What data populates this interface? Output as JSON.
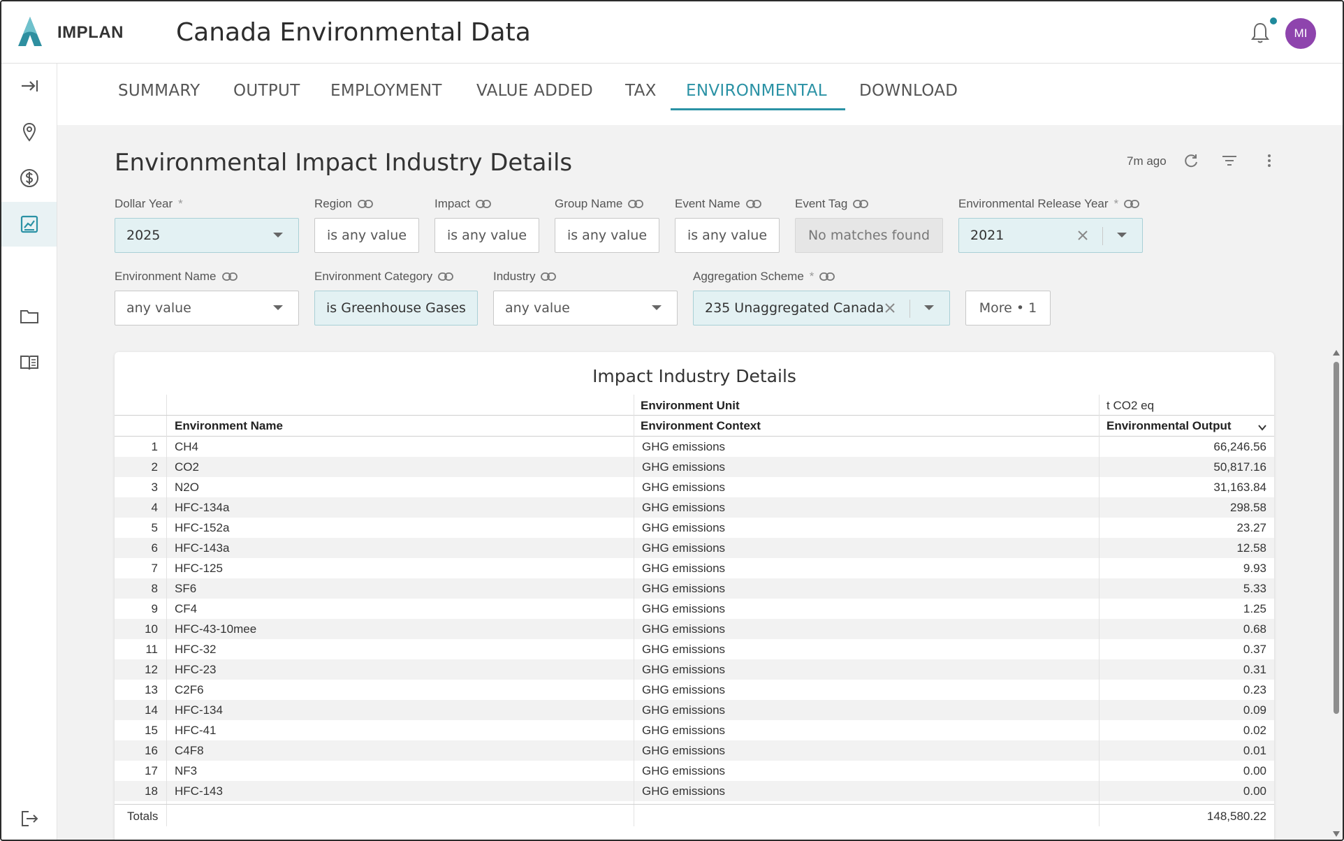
{
  "header": {
    "brand": "IMPLAN",
    "app_title": "Canada Environmental Data",
    "avatar_initials": "MI"
  },
  "sidebar": {
    "items": [
      {
        "icon": "collapse-arrow-icon"
      },
      {
        "icon": "location-pin-icon"
      },
      {
        "icon": "dollar-icon"
      },
      {
        "icon": "chart-icon",
        "active": true
      },
      {
        "icon": "folder-icon"
      },
      {
        "icon": "book-icon"
      },
      {
        "icon": "logout-icon"
      }
    ]
  },
  "tabs": [
    {
      "label": "SUMMARY"
    },
    {
      "label": "OUTPUT"
    },
    {
      "label": "EMPLOYMENT"
    },
    {
      "label": "VALUE ADDED"
    },
    {
      "label": "TAX"
    },
    {
      "label": "ENVIRONMENTAL",
      "active": true
    },
    {
      "label": "DOWNLOAD"
    }
  ],
  "page": {
    "title": "Environmental Impact Industry Details",
    "updated": "7m ago"
  },
  "filters": {
    "dollar_year": {
      "label": "Dollar Year",
      "required": "*",
      "value": "2025"
    },
    "region": {
      "label": "Region",
      "value": "is any value"
    },
    "impact": {
      "label": "Impact",
      "value": "is any value"
    },
    "group_name": {
      "label": "Group Name",
      "value": "is any value"
    },
    "event_name": {
      "label": "Event Name",
      "value": "is any value"
    },
    "event_tag": {
      "label": "Event Tag",
      "value": "No matches found"
    },
    "env_release_year": {
      "label": "Environmental Release Year",
      "required": "*",
      "value": "2021"
    },
    "environment_name": {
      "label": "Environment Name",
      "value": "any value"
    },
    "environment_category": {
      "label": "Environment Category",
      "value": "is Greenhouse Gases"
    },
    "industry": {
      "label": "Industry",
      "value": "any value"
    },
    "aggregation_scheme": {
      "label": "Aggregation Scheme",
      "required": "*",
      "value": "235 Unaggregated Canada"
    },
    "more": {
      "label": "More • 1"
    }
  },
  "table": {
    "title": "Impact Industry Details",
    "header_top": {
      "unit_label": "Environment Unit",
      "unit_value": "t CO2 eq"
    },
    "columns": {
      "name": "Environment Name",
      "context": "Environment Context",
      "output": "Environmental Output"
    },
    "rows": [
      {
        "idx": "1",
        "name": "CH4",
        "context": "GHG emissions",
        "value": "66,246.56"
      },
      {
        "idx": "2",
        "name": "CO2",
        "context": "GHG emissions",
        "value": "50,817.16"
      },
      {
        "idx": "3",
        "name": "N2O",
        "context": "GHG emissions",
        "value": "31,163.84"
      },
      {
        "idx": "4",
        "name": "HFC-134a",
        "context": "GHG emissions",
        "value": "298.58"
      },
      {
        "idx": "5",
        "name": "HFC-152a",
        "context": "GHG emissions",
        "value": "23.27"
      },
      {
        "idx": "6",
        "name": "HFC-143a",
        "context": "GHG emissions",
        "value": "12.58"
      },
      {
        "idx": "7",
        "name": "HFC-125",
        "context": "GHG emissions",
        "value": "9.93"
      },
      {
        "idx": "8",
        "name": "SF6",
        "context": "GHG emissions",
        "value": "5.33"
      },
      {
        "idx": "9",
        "name": "CF4",
        "context": "GHG emissions",
        "value": "1.25"
      },
      {
        "idx": "10",
        "name": "HFC-43-10mee",
        "context": "GHG emissions",
        "value": "0.68"
      },
      {
        "idx": "11",
        "name": "HFC-32",
        "context": "GHG emissions",
        "value": "0.37"
      },
      {
        "idx": "12",
        "name": "HFC-23",
        "context": "GHG emissions",
        "value": "0.31"
      },
      {
        "idx": "13",
        "name": "C2F6",
        "context": "GHG emissions",
        "value": "0.23"
      },
      {
        "idx": "14",
        "name": "HFC-134",
        "context": "GHG emissions",
        "value": "0.09"
      },
      {
        "idx": "15",
        "name": "HFC-41",
        "context": "GHG emissions",
        "value": "0.02"
      },
      {
        "idx": "16",
        "name": "C4F8",
        "context": "GHG emissions",
        "value": "0.01"
      },
      {
        "idx": "17",
        "name": "NF3",
        "context": "GHG emissions",
        "value": "0.00"
      },
      {
        "idx": "18",
        "name": "HFC-143",
        "context": "GHG emissions",
        "value": "0.00"
      }
    ],
    "totals_label": "Totals",
    "totals_value": "148,580.22"
  },
  "colors": {
    "accent": "#2b92a5",
    "avatar": "#8e44ad",
    "filled_filter": "#e3f1f3"
  }
}
